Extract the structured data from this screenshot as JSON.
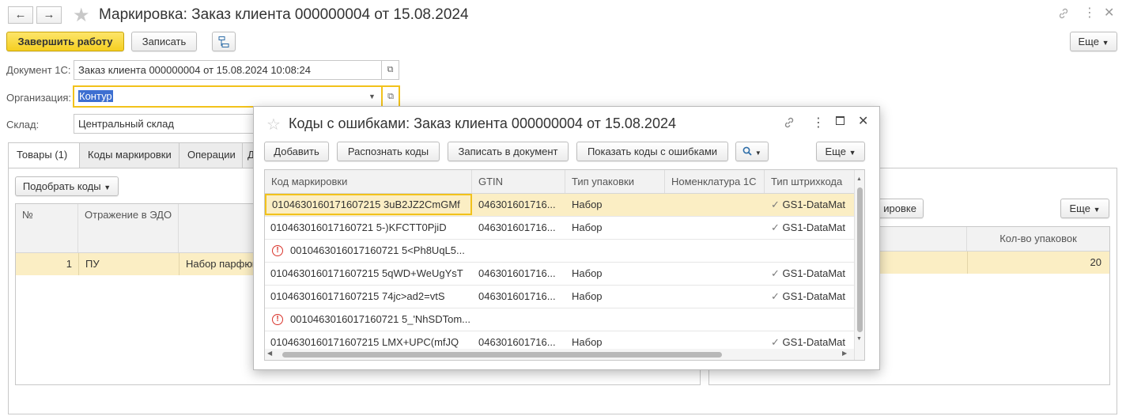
{
  "header": {
    "title": "Маркировка: Заказ клиента 000000004 от 15.08.2024",
    "back_icon": "arrow-left-icon",
    "forward_icon": "arrow-right-icon",
    "star_icon": "star-icon"
  },
  "toolbar": {
    "finish_label": "Завершить работу",
    "save_label": "Записать",
    "more_label": "Еще"
  },
  "form": {
    "document_label": "Документ 1С:",
    "document_value": "Заказ клиента 000000004 от 15.08.2024 10:08:24",
    "organization_label": "Организация:",
    "organization_value": "Контур",
    "warehouse_label": "Склад:",
    "warehouse_value": "Центральный склад"
  },
  "tabs": [
    {
      "label": "Товары (1)"
    },
    {
      "label": "Коды маркировки"
    },
    {
      "label": "Операции"
    },
    {
      "label": "Д"
    }
  ],
  "goods": {
    "pick_codes_label": "Подобрать коды",
    "columns": [
      "№",
      "Отражение в ЭДО"
    ],
    "rows": [
      {
        "num": "1",
        "edo": "ПУ",
        "name": "Набор парфюм"
      }
    ]
  },
  "right_panel": {
    "button_label": "ировке",
    "more_label": "Еще",
    "column": "Кол-во упаковок",
    "value": "20"
  },
  "modal": {
    "title": "Коды с ошибками: Заказ клиента 000000004 от 15.08.2024",
    "buttons": {
      "add": "Добавить",
      "recognize": "Распознать коды",
      "write": "Записать в документ",
      "show_errors": "Показать коды с ошибками",
      "more": "Еще"
    },
    "columns": [
      "Код маркировки",
      "GTIN",
      "Тип упаковки",
      "Номенклатура 1С",
      "Тип штрихкода"
    ],
    "rows": [
      {
        "code": "0104630160171607215 3uB2JZ2CmGMf",
        "gtin": "046301601716...",
        "pack": "Набор",
        "nom": "",
        "barcode": "GS1-DataMat",
        "error": false,
        "selected": true
      },
      {
        "code": "010463016017160721 5-)KFCTT0PjiD",
        "gtin": "046301601716...",
        "pack": "Набор",
        "nom": "",
        "barcode": "GS1-DataMat",
        "error": false,
        "selected": false
      },
      {
        "code": "0010463016017160721 5<Ph8UqL5...",
        "gtin": "",
        "pack": "",
        "nom": "",
        "barcode": "",
        "error": true,
        "selected": false
      },
      {
        "code": "0104630160171607215 5qWD+WeUgYsT",
        "gtin": "046301601716...",
        "pack": "Набор",
        "nom": "",
        "barcode": "GS1-DataMat",
        "error": false,
        "selected": false
      },
      {
        "code": "0104630160171607215 74jc>ad2=vtS",
        "gtin": "046301601716...",
        "pack": "Набор",
        "nom": "",
        "barcode": "GS1-DataMat",
        "error": false,
        "selected": false
      },
      {
        "code": "0010463016017160721 5_'NhSDTom...",
        "gtin": "",
        "pack": "",
        "nom": "",
        "barcode": "",
        "error": true,
        "selected": false
      },
      {
        "code": "0104630160171607215 LMX+UPC(mfJQ",
        "gtin": "046301601716...",
        "pack": "Набор",
        "nom": "",
        "barcode": "GS1-DataMat",
        "error": false,
        "selected": false
      }
    ]
  },
  "colors": {
    "accent_yellow": "#f5cf21",
    "selection": "#fbeec4",
    "error_red": "#d9342b"
  }
}
